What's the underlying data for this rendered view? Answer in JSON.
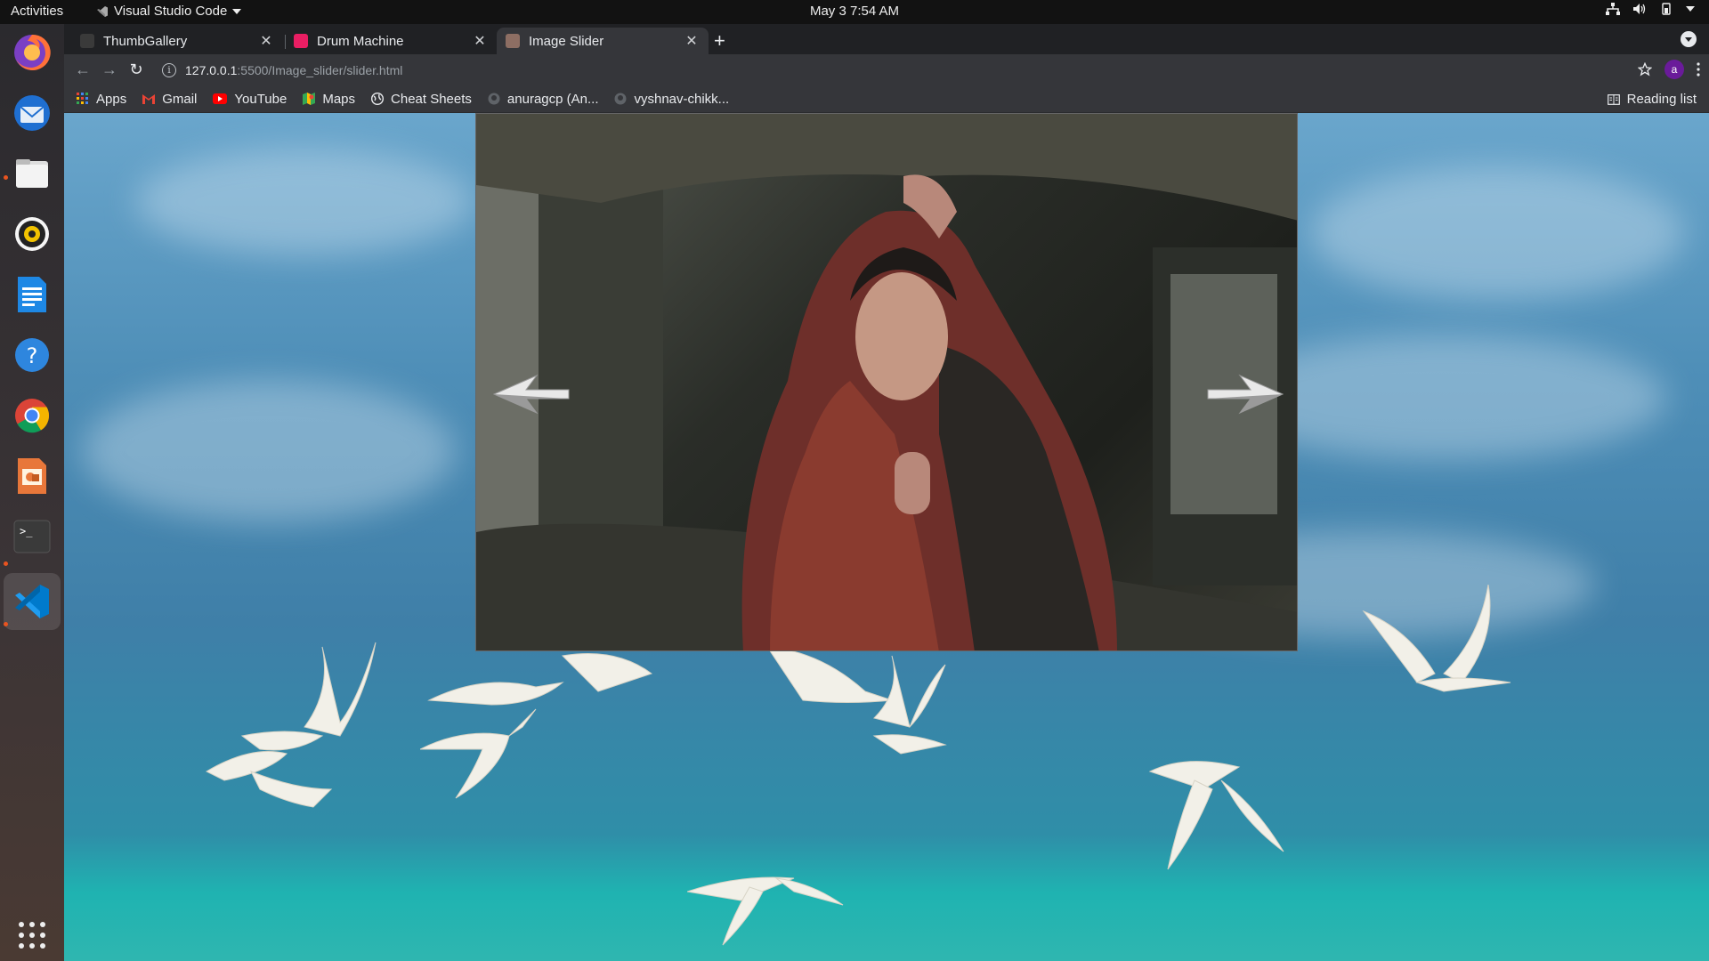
{
  "topbar": {
    "activities": "Activities",
    "app_name": "Visual Studio Code",
    "clock": "May 3  7:54 AM"
  },
  "dock": {
    "items": [
      "firefox-icon",
      "thunderbird-icon",
      "files-icon",
      "rhythmbox-icon",
      "libreoffice-writer-icon",
      "help-icon",
      "chrome-icon",
      "impress-icon",
      "terminal-icon",
      "vscode-icon",
      "show-apps-icon"
    ]
  },
  "tabs": [
    {
      "title": "ThumbGallery",
      "favicon_color": "#3a3a3a"
    },
    {
      "title": "Drum Machine",
      "favicon_color": "#e91e63"
    },
    {
      "title": "Image Slider",
      "favicon_color": "#8d6e63"
    }
  ],
  "url": {
    "host": "127.0.0.1",
    "path": ":5500/Image_slider/slider.html"
  },
  "bookmarks": [
    {
      "label": "Apps",
      "icon": "apps-grid-icon",
      "color": "#4285f4"
    },
    {
      "label": "Gmail",
      "icon": "gmail-icon",
      "color": "#ea4335"
    },
    {
      "label": "YouTube",
      "icon": "youtube-icon",
      "color": "#ff0000"
    },
    {
      "label": "Maps",
      "icon": "maps-icon",
      "color": "#34a853"
    },
    {
      "label": "Cheat Sheets",
      "icon": "globe-icon",
      "color": "#e8eaed"
    },
    {
      "label": "anuragcp (An...",
      "icon": "github-icon",
      "color": "#9aa0a6"
    },
    {
      "label": "vyshnav-chikk...",
      "icon": "github-icon",
      "color": "#9aa0a6"
    }
  ],
  "reading_list": "Reading list",
  "profile_initial": "a",
  "colors": {
    "accent_purple": "#6a1b9a",
    "ubuntu_orange": "#e95420",
    "vscode_blue": "#007acc"
  }
}
